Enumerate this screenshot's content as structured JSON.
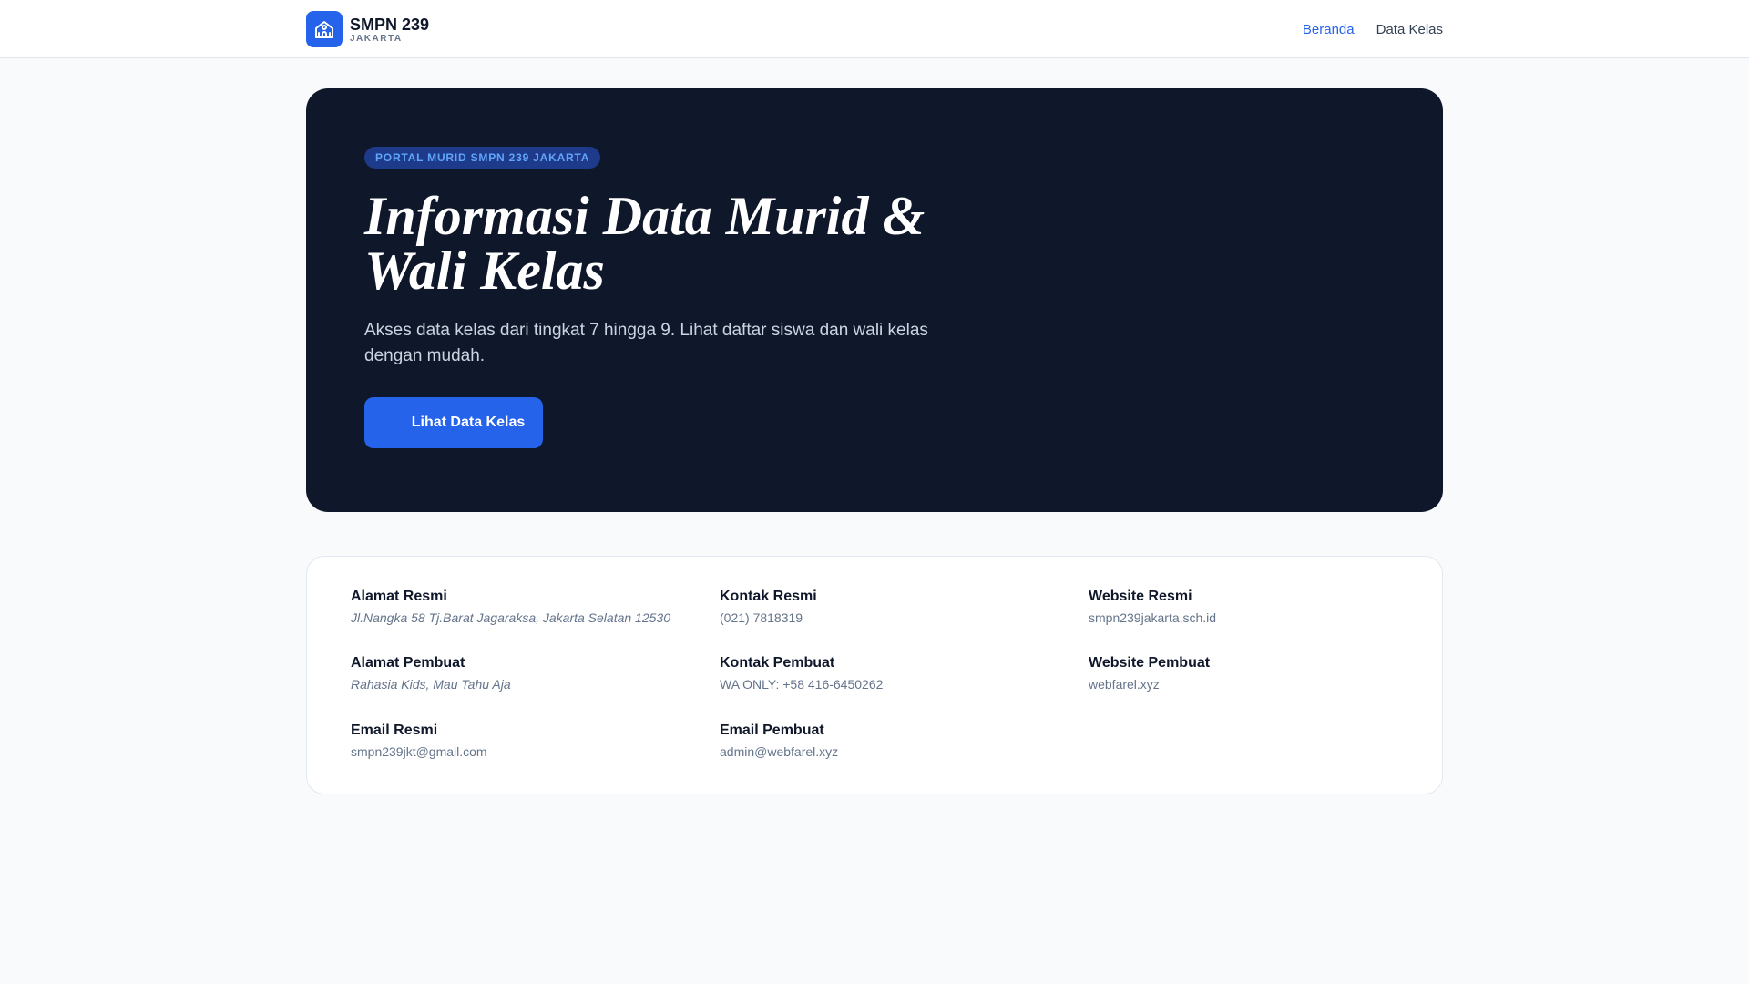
{
  "header": {
    "brand": "SMPN 239",
    "subtitle": "JAKARTA",
    "nav": [
      "Beranda",
      "Data Kelas"
    ]
  },
  "hero": {
    "badge": "PORTAL MURID SMPN 239 JAKARTA",
    "title": "Informasi Data Murid & Wali Kelas",
    "description": "Akses data kelas dari tingkat 7 hingga 9. Lihat daftar siswa dan wali kelas dengan mudah.",
    "button": "Lihat Data Kelas"
  },
  "info": [
    {
      "label": "Alamat Resmi",
      "value": "Jl.Nangka 58 Tj.Barat Jagaraksa, Jakarta Selatan 12530"
    },
    {
      "label": "Kontak Resmi",
      "value": "(021) 7818319"
    },
    {
      "label": "Website Resmi",
      "value": "smpn239jakarta.sch.id"
    },
    {
      "label": "Alamat Pembuat",
      "value": "Rahasia Kids, Mau Tahu Aja"
    },
    {
      "label": "Kontak Pembuat",
      "value": "WA ONLY: +58 416-6450262"
    },
    {
      "label": "Website Pembuat",
      "value": "webfarel.xyz"
    },
    {
      "label": "Email Resmi",
      "value": "smpn239jkt@gmail.com"
    },
    {
      "label": "Email Pembuat",
      "value": "admin@webfarel.xyz"
    }
  ]
}
